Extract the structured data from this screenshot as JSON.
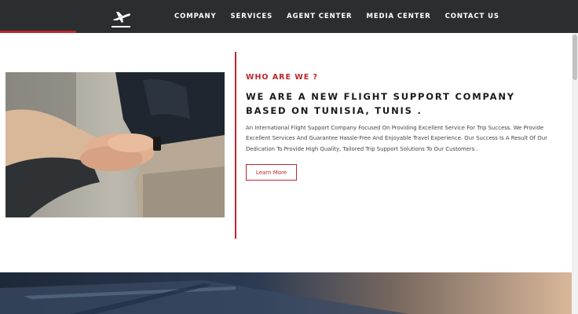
{
  "nav": {
    "logo_icon": "airplane-takeoff-icon",
    "links": [
      "COMPANY",
      "SERVICES",
      "AGENT CENTER",
      "MEDIA CENTER",
      "CONTACT US"
    ],
    "active_accent_color": "#c0242b",
    "background": "#2b2e31"
  },
  "about": {
    "eyebrow": "WHO ARE WE ?",
    "headline": "WE ARE A NEW FLIGHT SUPPORT COMPANY BASED ON TUNISIA, TUNIS .",
    "body": "An International Flight Support Company Focused On Providing Excellent Service For Trip Success. We Provide Excellent Services And Guarantee Hassle-Free And Enjoyable Travel Experience. Our Success Is A Result Of Our Dedication To Provide High Quality, Tailored Trip Support Solutions To Our Customers .",
    "button_label": "Learn More"
  },
  "colors": {
    "accent": "#c0242b",
    "text": "#1a1a1a"
  }
}
